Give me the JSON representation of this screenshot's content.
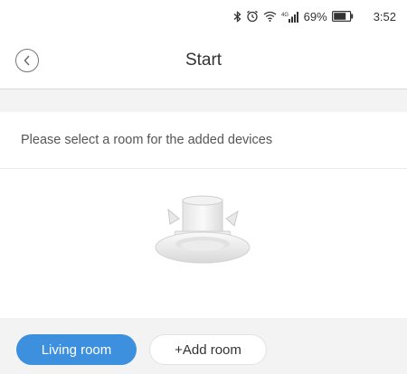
{
  "status_bar": {
    "battery": "69%",
    "time": "3:52",
    "network_label": "4G",
    "icons": [
      "bluetooth-icon",
      "alarm-icon",
      "wifi-icon",
      "signal-icon",
      "battery-icon"
    ]
  },
  "header": {
    "title": "Start",
    "back_icon": "chevron-left-icon"
  },
  "prompt": "Please select a room for the added devices",
  "device": {
    "image": "recessed-downlight"
  },
  "rooms": {
    "items": [
      {
        "label": "Living room",
        "selected": true
      }
    ],
    "add_label": "+Add room"
  },
  "colors": {
    "accent": "#3d90dd",
    "background_gray": "#f3f3f3",
    "divider": "#d9d9d9"
  }
}
